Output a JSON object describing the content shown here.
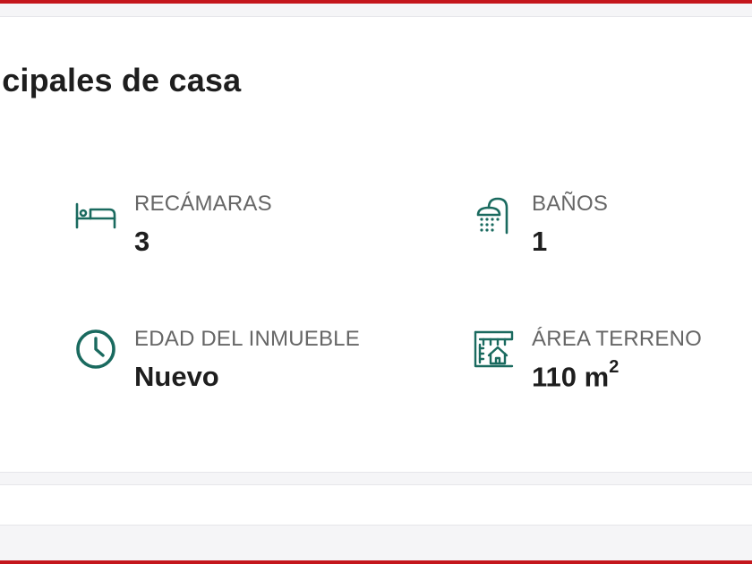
{
  "section": {
    "title": "ncipales de casa"
  },
  "features": {
    "bedrooms": {
      "label": "RECÁMARAS",
      "value": "3",
      "icon": "bed-icon"
    },
    "bathrooms": {
      "label": "BAÑOS",
      "value": "1",
      "icon": "shower-icon"
    },
    "age": {
      "label": "EDAD DEL INMUEBLE",
      "value": "Nuevo",
      "icon": "clock-icon"
    },
    "land_area": {
      "label": "ÁREA TERRENO",
      "value": "110 m",
      "unit_exp": "2",
      "icon": "land-area-icon"
    }
  },
  "colors": {
    "accent_border": "#c4161c",
    "icon": "#1a6a5f",
    "label": "#666666",
    "value": "#1e1e1e"
  }
}
